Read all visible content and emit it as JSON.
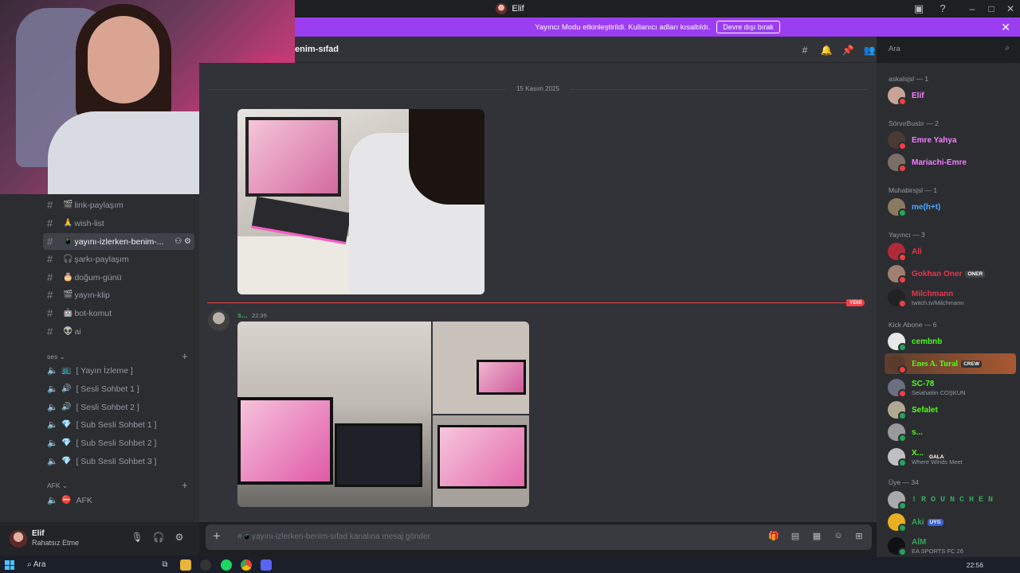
{
  "window": {
    "title": "Elif"
  },
  "banner": {
    "text": "Yayıncı Modu etkinleştirildi. Kullanıcı adları kısaltıldı.",
    "button": "Devre dışı bırak"
  },
  "channel_header": {
    "name": "enim-sıfad"
  },
  "search": {
    "placeholder": "Ara"
  },
  "channels": [
    {
      "emoji": "🎬",
      "label": "link-paylaşım"
    },
    {
      "emoji": "🙏",
      "label": "wish-list"
    },
    {
      "emoji": "📱",
      "label": "yayını-izlerken-benim-..."
    },
    {
      "emoji": "🎧",
      "label": "şarkı-paylaşım"
    },
    {
      "emoji": "🎂",
      "label": "doğum-günü"
    },
    {
      "emoji": "🎬",
      "label": "yayın-klip"
    },
    {
      "emoji": "🤖",
      "label": "bot-komut"
    },
    {
      "emoji": "👽",
      "label": "ai"
    }
  ],
  "categories": {
    "ses": "ses",
    "afk": "AFK"
  },
  "voice_channels": [
    {
      "emoji": "📺",
      "label": "[ Yayın İzleme ]"
    },
    {
      "emoji": "🔊",
      "label": "[ Sesli Sohbet 1 ]"
    },
    {
      "emoji": "🔊",
      "label": "[ Sesli Sohbet 2 ]"
    },
    {
      "emoji": "💎",
      "label": "[ Sub Sesli Sohbet 1 ]"
    },
    {
      "emoji": "💎",
      "label": "[ Sub Sesli Sohbet 2 ]"
    },
    {
      "emoji": "💎",
      "label": "[ Sub Sesli Sohbet 3 ]"
    }
  ],
  "afk_channel": {
    "emoji": "⛔",
    "label": "AFK"
  },
  "user": {
    "name": "Elif",
    "status": "Rahatsız Etme"
  },
  "chat": {
    "date_divider": "15 Kasım 2025",
    "new_badge": "YENİ",
    "message": {
      "author": "s...",
      "time": "22:39"
    },
    "composer_placeholder": "yayını-izlerken-benim-sıfad kanalına mesaj gönder"
  },
  "member_groups": [
    {
      "title": "askalsjsl — 1",
      "members": [
        {
          "name": "Elif",
          "color": "#f47fff"
        }
      ]
    },
    {
      "title": "SörvırBustır — 2",
      "members": [
        {
          "name": "Emre Yahya",
          "color": "#f47fff"
        },
        {
          "name": "Mariachi-Emre",
          "color": "#f47fff"
        }
      ]
    },
    {
      "title": "Muhabirsjsl — 1",
      "members": [
        {
          "name": "me(h+t)",
          "color": "#4fa6ff"
        }
      ]
    },
    {
      "title": "Yayıncı — 3",
      "members": [
        {
          "name": "Ali",
          "color": "#e8364b"
        },
        {
          "name": "Gokhan Oner",
          "color": "#e8364b",
          "badge": "ONER"
        },
        {
          "name": "Milchmann",
          "color": "#e8364b",
          "sub": "twitch.tv/Milchmann"
        }
      ]
    },
    {
      "title": "Kick Abone — 6",
      "members": [
        {
          "name": "cembnb",
          "color": "#53fc18"
        },
        {
          "name": "Enes A. Tural",
          "color": "#53fc18",
          "badge": "CREW"
        },
        {
          "name": "SC-78",
          "color": "#53fc18",
          "sub": "Selahattin COŞKUN"
        },
        {
          "name": "Sefalet",
          "color": "#53fc18"
        },
        {
          "name": "s...",
          "color": "#53fc18"
        },
        {
          "name": "X...",
          "color": "#53fc18",
          "badge": "GALA",
          "sub": "Where Winds Meet"
        }
      ]
    },
    {
      "title": "Üye — 34",
      "members": [
        {
          "name": "! R O U N C H E N",
          "color": "#3ba55c"
        },
        {
          "name": "Aki",
          "color": "#3ba55c",
          "badge": "UYG"
        },
        {
          "name": "AİM",
          "color": "#3ba55c",
          "sub": "EA SPORTS FC 26"
        }
      ]
    }
  ],
  "taskbar": {
    "search": "Ara",
    "time": "22:56"
  }
}
